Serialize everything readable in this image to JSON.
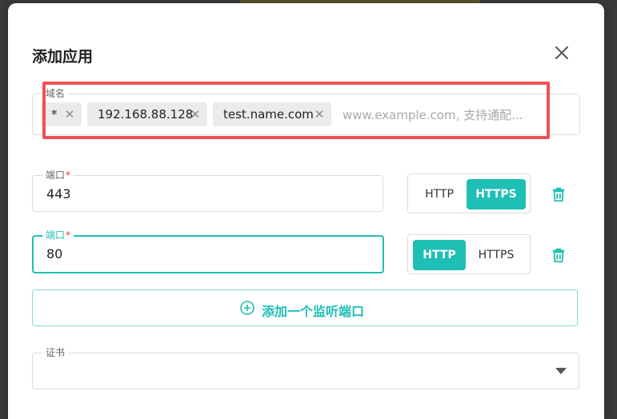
{
  "dialog": {
    "title": "添加应用",
    "close_icon": "close-icon"
  },
  "domain": {
    "label": "域名",
    "chips": [
      "*",
      "192.168.88.128",
      "test.name.com"
    ],
    "placeholder": "www.example.com, 支持通配..."
  },
  "ports": [
    {
      "label": "端口",
      "required": "*",
      "value": "443",
      "protocols": [
        "HTTP",
        "HTTPS"
      ],
      "selected": "HTTPS",
      "focused": false
    },
    {
      "label": "端口",
      "required": "*",
      "value": "80",
      "protocols": [
        "HTTP",
        "HTTPS"
      ],
      "selected": "HTTP",
      "focused": true
    }
  ],
  "add_port": {
    "label": "添加一个监听端口",
    "icon": "plus-circle-icon"
  },
  "certificate": {
    "label": "证书",
    "value": "",
    "icon": "caret-down-icon"
  },
  "colors": {
    "accent": "#1ebfb4",
    "highlight": "#ec5255",
    "required": "#e33333"
  }
}
